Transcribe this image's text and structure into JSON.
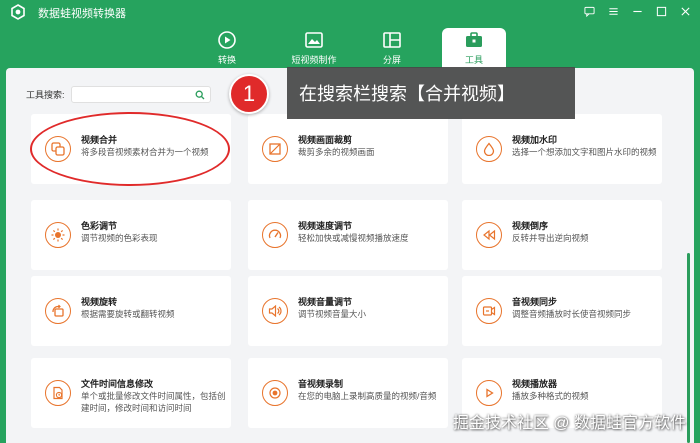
{
  "app": {
    "title": "数据蛙视频转换器",
    "accent": "#26a35e",
    "icon_accent": "#e8742c"
  },
  "window_controls": [
    "chat-icon",
    "menu-icon",
    "minimize-icon",
    "maximize-icon",
    "close-icon"
  ],
  "tabs": [
    {
      "label": "转换",
      "icon": "convert-icon",
      "active": false
    },
    {
      "label": "短视频制作",
      "icon": "short-video-icon",
      "active": false
    },
    {
      "label": "分屏",
      "icon": "split-screen-icon",
      "active": false
    },
    {
      "label": "工具",
      "icon": "toolbox-icon",
      "active": true
    }
  ],
  "search": {
    "label": "工具搜索:",
    "placeholder": "",
    "value": ""
  },
  "tools": [
    {
      "title": "视频合并",
      "desc": "将多段音视频素材合并为一个视频",
      "icon": "merge-icon"
    },
    {
      "title": "视频画面裁剪",
      "desc": "裁剪多余的视频画面",
      "icon": "crop-icon"
    },
    {
      "title": "视频加水印",
      "desc": "选择一个想添加文字和图片水印的视频",
      "icon": "watermark-icon"
    },
    {
      "title": "色彩调节",
      "desc": "调节视频的色彩表现",
      "icon": "color-icon"
    },
    {
      "title": "视频速度调节",
      "desc": "轻松加快或减慢视频播放速度",
      "icon": "speed-icon"
    },
    {
      "title": "视频倒序",
      "desc": "反转并导出逆向视频",
      "icon": "reverse-icon"
    },
    {
      "title": "视频旋转",
      "desc": "根据需要旋转或翻转视频",
      "icon": "rotate-icon"
    },
    {
      "title": "视频音量调节",
      "desc": "调节视频音量大小",
      "icon": "volume-icon"
    },
    {
      "title": "音视频同步",
      "desc": "调整音频播放时长使音视频同步",
      "icon": "sync-icon"
    },
    {
      "title": "文件时间信息修改",
      "desc": "单个或批量修改文件时间属性，包括创建时间，修改时间和访问时间",
      "icon": "file-time-icon"
    },
    {
      "title": "音视频录制",
      "desc": "在您的电脑上录制高质量的视频/音频",
      "icon": "record-icon"
    },
    {
      "title": "视频播放器",
      "desc": "播放多种格式的视频",
      "icon": "player-icon"
    }
  ],
  "callout": {
    "step": "1",
    "text": "在搜索栏搜索【合并视频】"
  },
  "watermark": "掘金技术社区 @ 数据蛙官方软件"
}
